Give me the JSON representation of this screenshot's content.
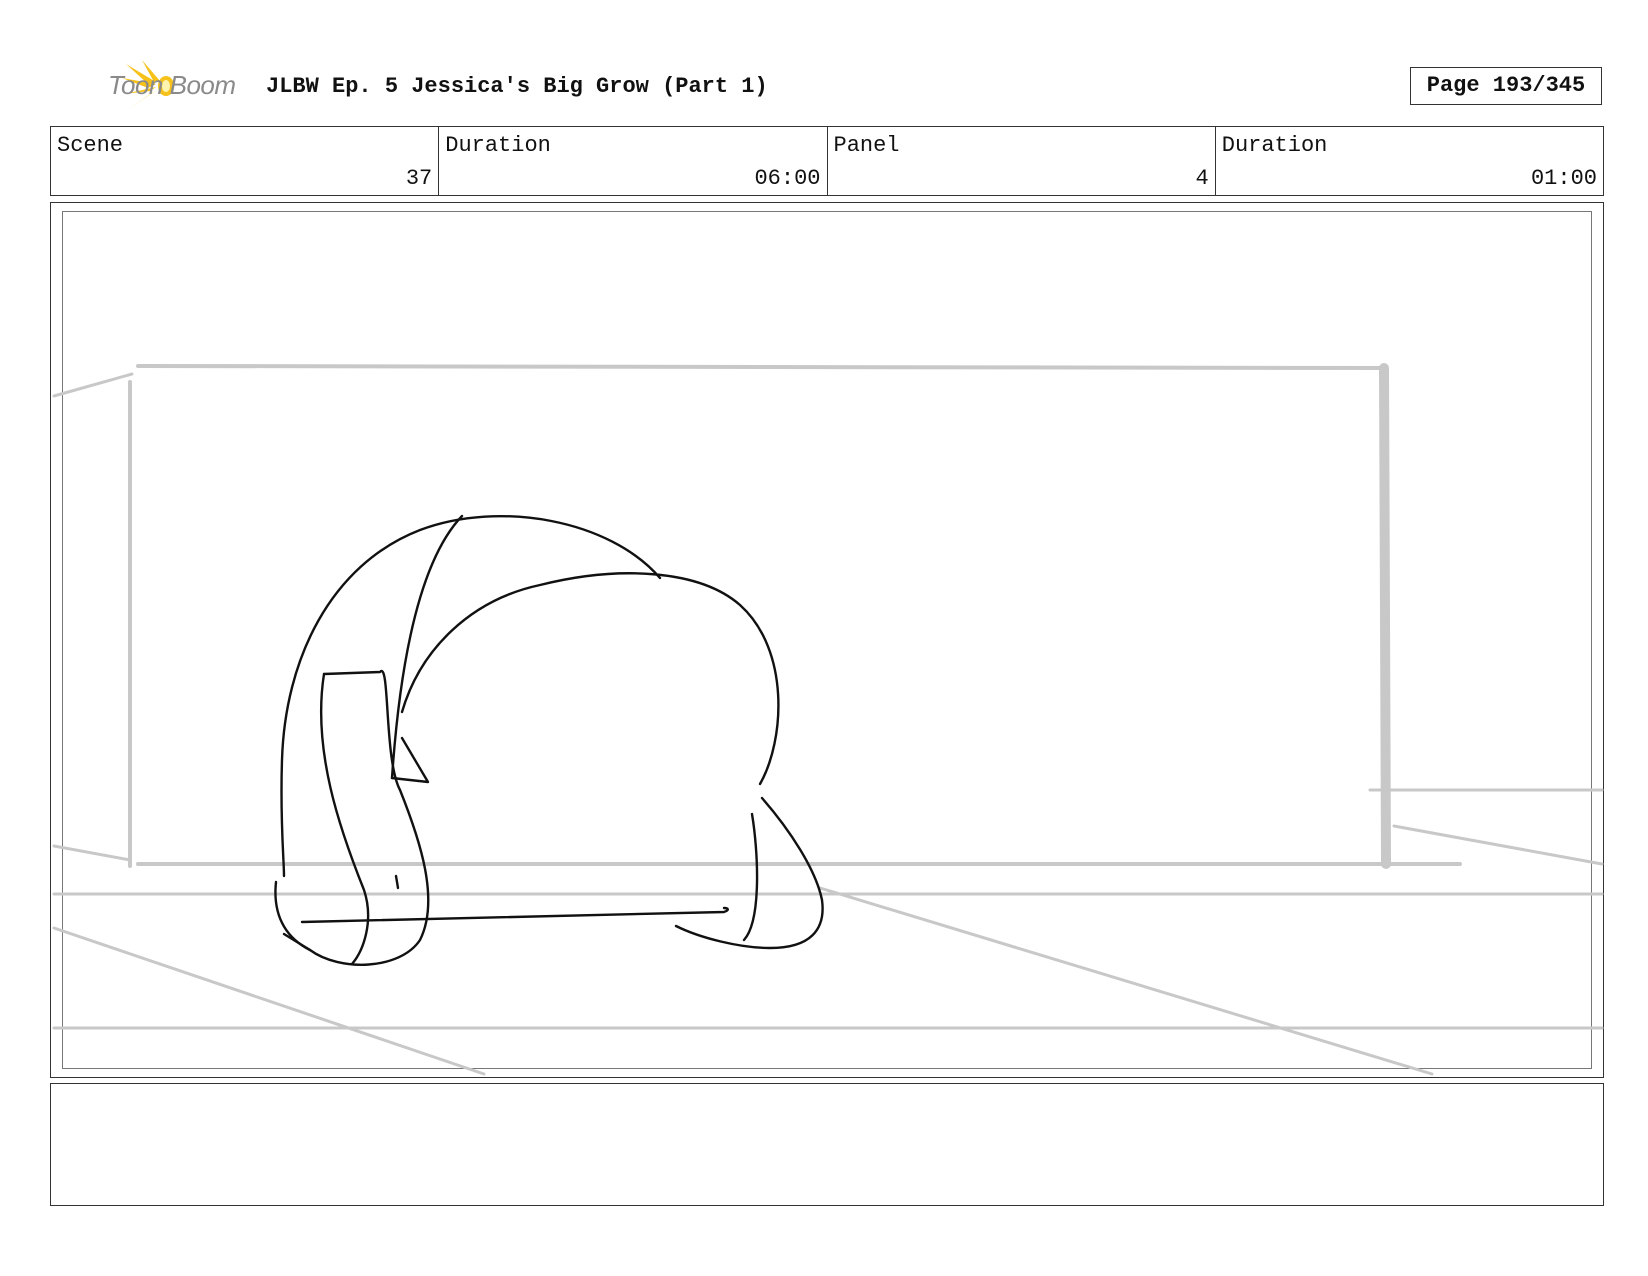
{
  "header": {
    "logo_text": "Toon Boom",
    "title": "JLBW Ep. 5 Jessica's Big Grow (Part 1)",
    "page": "Page 193/345"
  },
  "info": {
    "scene_label": "Scene",
    "scene_value": "37",
    "scene_duration_label": "Duration",
    "scene_duration_value": "06:00",
    "panel_label": "Panel",
    "panel_value": "4",
    "panel_duration_label": "Duration",
    "panel_duration_value": "01:00"
  },
  "notes": {
    "text": ""
  }
}
